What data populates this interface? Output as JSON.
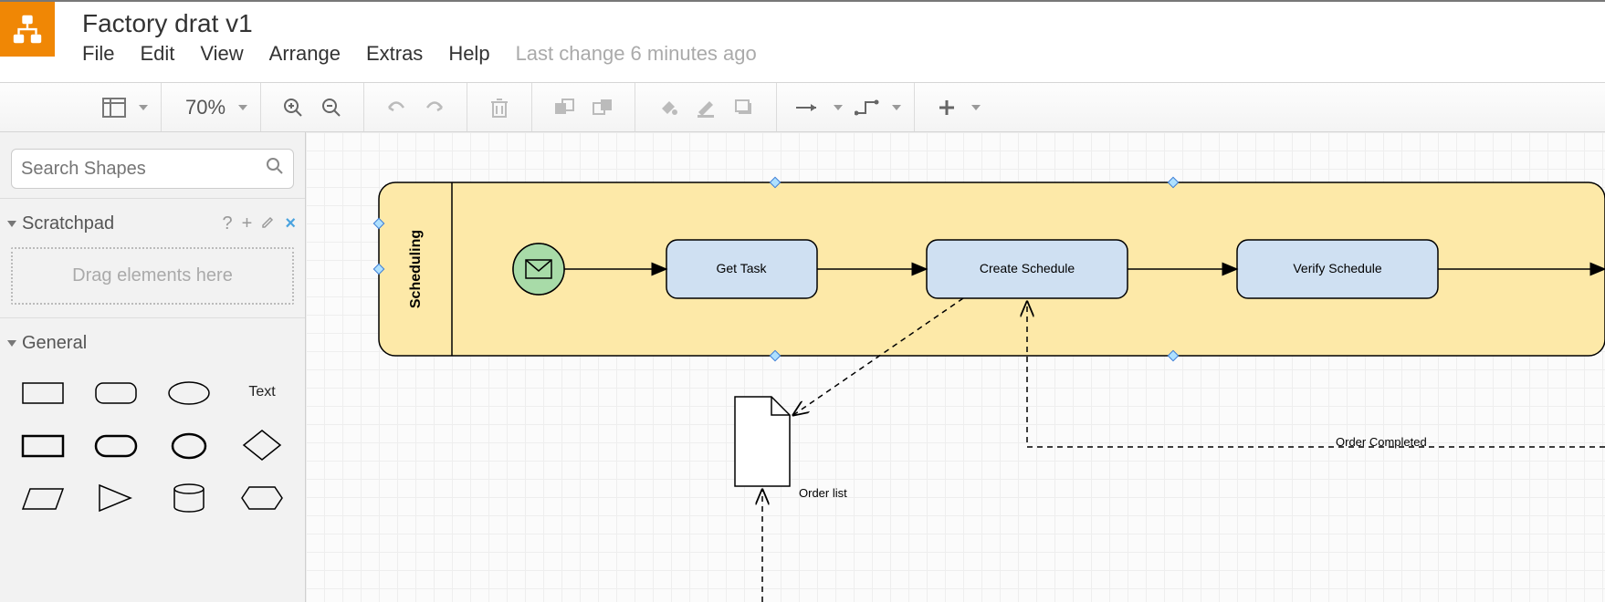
{
  "document": {
    "title": "Factory drat v1",
    "last_change": "Last change 6 minutes ago"
  },
  "menu": {
    "file": "File",
    "edit": "Edit",
    "view": "View",
    "arrange": "Arrange",
    "extras": "Extras",
    "help": "Help"
  },
  "toolbar": {
    "zoom": "70%"
  },
  "sidebar": {
    "search_placeholder": "Search Shapes",
    "scratchpad_label": "Scratchpad",
    "scratchpad_drop": "Drag elements here",
    "general_label": "General",
    "text_shape_label": "Text"
  },
  "diagram": {
    "pool_label": "Scheduling",
    "tasks": {
      "get_task": "Get Task",
      "create_schedule": "Create Schedule",
      "verify_schedule": "Verify Schedule"
    },
    "artifacts": {
      "order_list": "Order list",
      "order_completed": "Order Completed"
    }
  }
}
